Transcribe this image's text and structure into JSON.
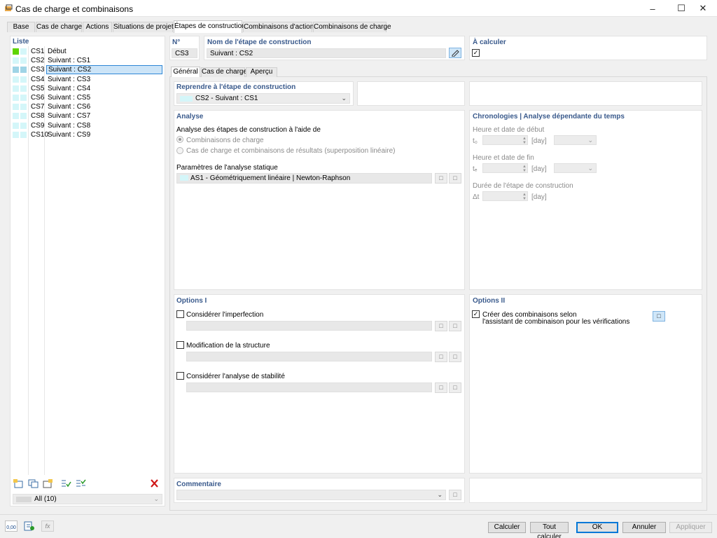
{
  "window": {
    "title": "Cas de charge et combinaisons"
  },
  "tabs": [
    "Base",
    "Cas de charge",
    "Actions",
    "Situations de projet",
    "Étapes de construction",
    "Combinaisons d'actions",
    "Combinaisons de charge"
  ],
  "list": {
    "header": "Liste",
    "items": [
      {
        "num": "CS1",
        "text": "Début",
        "c1": "#5fd400",
        "c2": "#d4f6f9"
      },
      {
        "num": "CS2",
        "text": "Suivant : CS1",
        "c1": "#d4f6f9",
        "c2": "#d4f6f9"
      },
      {
        "num": "CS3",
        "text": "Suivant : CS2",
        "c1": "#9fd4e6",
        "c2": "#9fd4e6"
      },
      {
        "num": "CS4",
        "text": "Suivant : CS3",
        "c1": "#d4f6f9",
        "c2": "#d4f6f9"
      },
      {
        "num": "CS5",
        "text": "Suivant : CS4",
        "c1": "#d4f6f9",
        "c2": "#d4f6f9"
      },
      {
        "num": "CS6",
        "text": "Suivant : CS5",
        "c1": "#d4f6f9",
        "c2": "#d4f6f9"
      },
      {
        "num": "CS7",
        "text": "Suivant : CS6",
        "c1": "#d4f6f9",
        "c2": "#d4f6f9"
      },
      {
        "num": "CS8",
        "text": "Suivant : CS7",
        "c1": "#d4f6f9",
        "c2": "#d4f6f9"
      },
      {
        "num": "CS9",
        "text": "Suivant : CS8",
        "c1": "#d4f6f9",
        "c2": "#d4f6f9"
      },
      {
        "num": "CS10",
        "text": "Suivant : CS9",
        "c1": "#d4f6f9",
        "c2": "#d4f6f9"
      }
    ],
    "filter": "All (10)"
  },
  "header": {
    "no_label": "N°",
    "no_value": "CS3",
    "name_label": "Nom de l'étape de construction",
    "name_value": "Suivant : CS2",
    "calc_label": "À calculer"
  },
  "subtabs": [
    "Général",
    "Cas de charge",
    "Aperçu"
  ],
  "resume": {
    "label": "Reprendre à l'étape de construction",
    "value": "CS2 - Suivant : CS1"
  },
  "analyse": {
    "header": "Analyse",
    "method_label": "Analyse des étapes de construction à l'aide de",
    "opt1": "Combinaisons de charge",
    "opt2": "Cas de charge et combinaisons de résultats (superposition linéaire)",
    "static_label": "Paramètres de l'analyse statique",
    "static_value": "AS1 - Géométriquement linéaire | Newton-Raphson"
  },
  "chrono": {
    "header": "Chronologies | Analyse dépendante du temps",
    "start_label": "Heure et date de début",
    "start_sym": "t₀",
    "unit": "[day]",
    "end_label": "Heure et date de fin",
    "end_sym": "tₑ",
    "dur_label": "Durée de l'étape de construction",
    "dur_sym": "Δt"
  },
  "options1": {
    "header": "Options I",
    "imperfection": "Considérer l'imperfection",
    "modification": "Modification de la structure",
    "stability": "Considérer l'analyse de stabilité"
  },
  "options2": {
    "header": "Options II",
    "combo_line1": "Créer des combinaisons selon",
    "combo_line2": "l'assistant de combinaison pour les vérifications"
  },
  "comment": {
    "header": "Commentaire"
  },
  "buttons": {
    "calculate": "Calculer",
    "calculate_all": "Tout calculer",
    "ok": "OK",
    "cancel": "Annuler",
    "apply": "Appliquer"
  },
  "bottom": {
    "units_label": "0,00"
  },
  "colors": {
    "accent": "#3a5a8c",
    "selection": "#cce4f7",
    "selection_border": "#2f87d6",
    "delete": "#d01818"
  }
}
